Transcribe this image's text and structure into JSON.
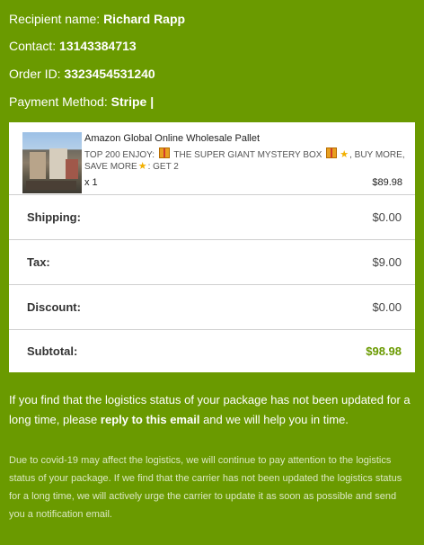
{
  "recipient": {
    "label": "Recipient name:",
    "value": "Richard Rapp"
  },
  "contact": {
    "label": "Contact:",
    "value": "13143384713"
  },
  "order": {
    "label": "Order ID:",
    "value": "3323454531240"
  },
  "payment": {
    "label": "Payment Method:",
    "value": "Stripe |"
  },
  "product": {
    "name": "Amazon Global Online Wholesale Pallet",
    "desc_part1": "TOP 200 ENJOY:",
    "desc_part2": "THE SUPER GIANT MYSTERY BOX",
    "desc_part3": ", BUY MORE, SAVE MORE",
    "desc_part4": ": GET 2",
    "quantity": "x 1",
    "price": "$89.98"
  },
  "summary": {
    "shipping": {
      "label": "Shipping:",
      "value": "$0.00"
    },
    "tax": {
      "label": "Tax:",
      "value": "$9.00"
    },
    "discount": {
      "label": "Discount:",
      "value": "$0.00"
    },
    "subtotal": {
      "label": "Subtotal:",
      "value": "$98.98"
    }
  },
  "notice": {
    "before": "If you find that the logistics status of your package has not been updated for a long time, please ",
    "emphasis": "reply to this email",
    "after": " and we will help you in time."
  },
  "covid_note": "Due to covid-19 may affect the logistics, we will continue to pay attention to the logistics status of your package. If we find that the carrier has not been updated the logistics status for a long time, we will actively urge the carrier to update it as soon as possible and send you a notification email.",
  "colors": {
    "background": "#6a9a00",
    "accent": "#6a9a00"
  }
}
